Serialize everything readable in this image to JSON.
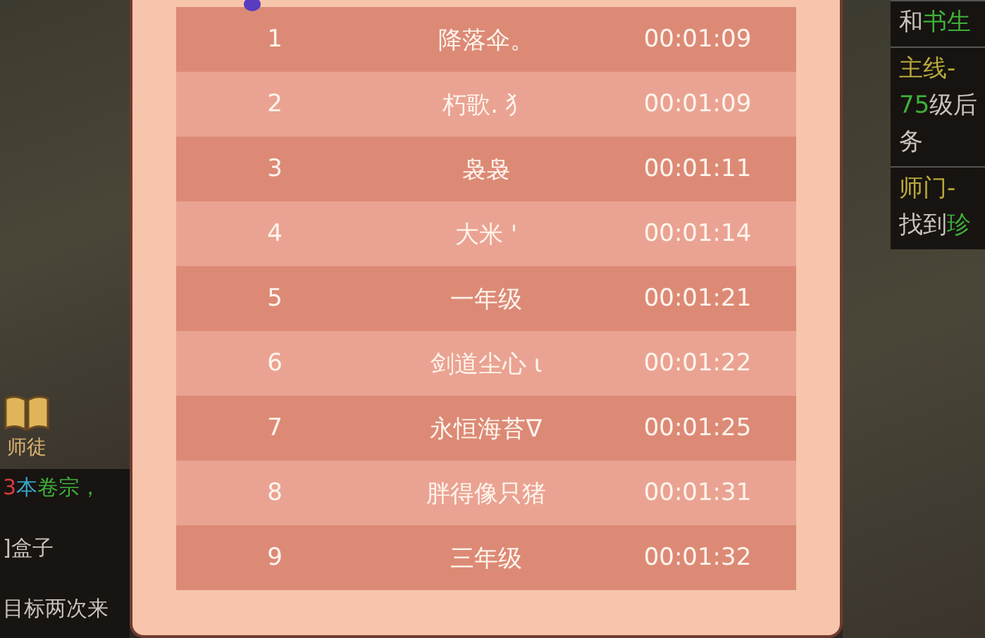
{
  "side_menu": {
    "label": "师徒"
  },
  "chat": [
    [
      {
        "text": "3",
        "kind": "number"
      },
      {
        "text": "本",
        "kind": "item"
      },
      {
        "text": "卷宗，",
        "kind": "npc"
      }
    ],
    [
      {
        "text": "]盒子",
        "kind": "plain"
      }
    ],
    [
      {
        "text": "目标两次来",
        "kind": "plain"
      }
    ]
  ],
  "ranking": {
    "rows": [
      {
        "rank": "1",
        "name": "降落伞。",
        "time": "00:01:09"
      },
      {
        "rank": "2",
        "name": "朽歌. ⺨",
        "time": "00:01:09"
      },
      {
        "rank": "3",
        "name": "袅袅",
        "time": "00:01:11"
      },
      {
        "rank": "4",
        "name": "大米 '",
        "time": "00:01:14"
      },
      {
        "rank": "5",
        "name": "一年级",
        "time": "00:01:21"
      },
      {
        "rank": "6",
        "name": "剑道尘心 ι",
        "time": "00:01:22"
      },
      {
        "rank": "7",
        "name": "永恒海苔ᐁ",
        "time": "00:01:25"
      },
      {
        "rank": "8",
        "name": "胖得像只猪",
        "time": "00:01:31"
      },
      {
        "rank": "9",
        "name": "三年级",
        "time": "00:01:32"
      }
    ]
  },
  "quest_tracker": [
    {
      "lines": [
        [
          {
            "text": "和",
            "kind": "plain"
          },
          {
            "text": "书生",
            "kind": "npc"
          }
        ]
      ]
    },
    {
      "lines": [
        [
          {
            "text": "主线-",
            "kind": "title"
          }
        ],
        [
          {
            "text": "75",
            "kind": "npc"
          },
          {
            "text": "级后",
            "kind": "plain"
          }
        ],
        [
          {
            "text": "务",
            "kind": "plain"
          }
        ]
      ]
    },
    {
      "lines": [
        [
          {
            "text": "师门-",
            "kind": "title"
          }
        ],
        [
          {
            "text": "找到",
            "kind": "plain"
          },
          {
            "text": "珍",
            "kind": "npc"
          }
        ]
      ]
    }
  ]
}
